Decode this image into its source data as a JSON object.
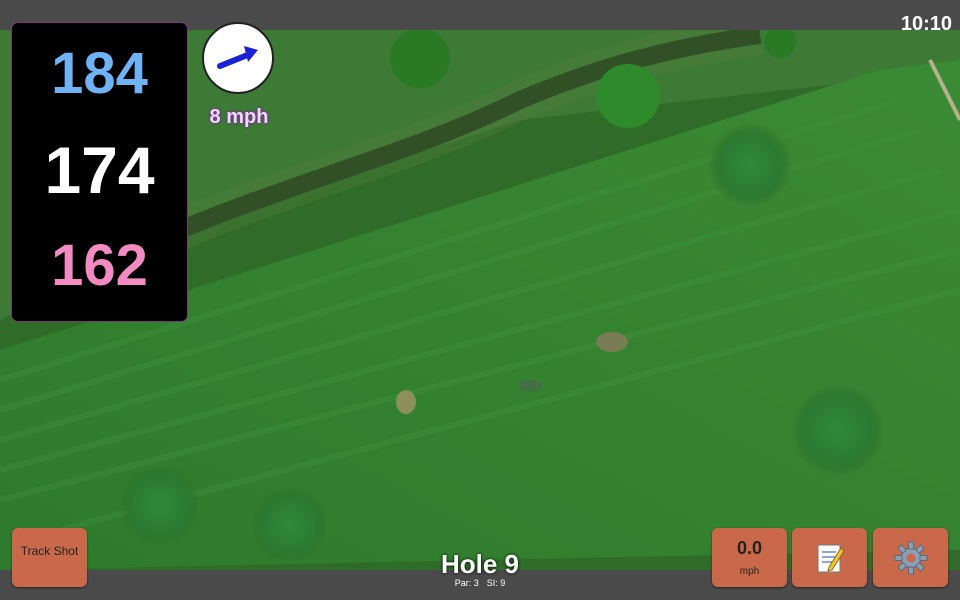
{
  "status": {
    "time": "10:10"
  },
  "distances": {
    "back": "184",
    "middle": "174",
    "front": "162"
  },
  "wind": {
    "speed_label": "8 mph",
    "direction_icon": "arrow-right-up-icon"
  },
  "buttons": {
    "track_shot": "Track Shot",
    "speed_value": "0.0",
    "speed_unit": "mph",
    "notes_icon": "memo-icon",
    "settings_icon": "gear-icon"
  },
  "hole": {
    "title": "Hole 9",
    "par": "Par: 3",
    "si": "SI: 9"
  },
  "colors": {
    "back": "#6fb3f5",
    "middle": "#ffffff",
    "front": "#f48ac2",
    "button": "#c9694a",
    "bars": "#4a4a4a"
  }
}
